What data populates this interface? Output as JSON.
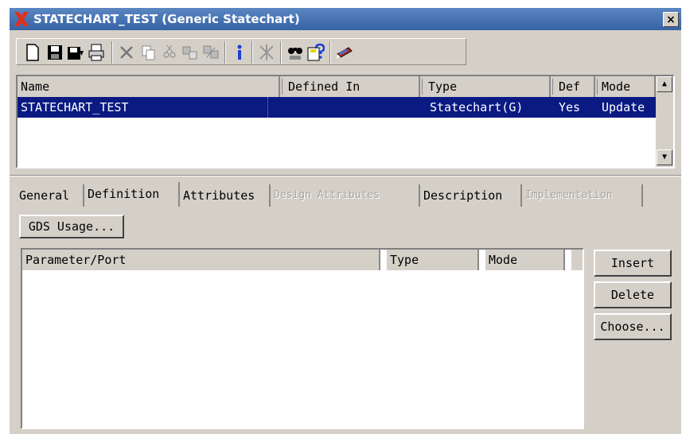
{
  "window": {
    "title": "STATECHART_TEST (Generic Statechart)",
    "close_label": "×",
    "accent": "#3763a6",
    "selection_color": "#0a1a82"
  },
  "toolbar": {
    "icons": [
      "new-icon",
      "save-icon",
      "save-as-icon",
      "print-icon",
      "delete-icon",
      "copy-icon",
      "paste-icon",
      "cut-icon",
      "compare-icon",
      "info-icon",
      "tools-icon",
      "find-icon",
      "help-icon",
      "pencil-icon"
    ]
  },
  "list": {
    "columns": [
      "Name",
      "Defined In",
      "Type",
      "Def",
      "Mode"
    ],
    "rows": [
      {
        "name": "STATECHART_TEST",
        "defined_in": "",
        "type": "Statechart(G)",
        "def": "Yes",
        "mode": "Update"
      }
    ]
  },
  "tabs": [
    {
      "label": "General",
      "state": "normal"
    },
    {
      "label": "Definition",
      "state": "active"
    },
    {
      "label": "Attributes",
      "state": "normal"
    },
    {
      "label": "Design Attributes",
      "state": "disabled"
    },
    {
      "label": "Description",
      "state": "normal"
    },
    {
      "label": "Implementation",
      "state": "disabled"
    }
  ],
  "definition": {
    "gds_usage_label": "GDS Usage...",
    "param_columns": [
      "Parameter/Port",
      "Type",
      "Mode"
    ],
    "buttons": {
      "insert": "Insert",
      "delete": "Delete",
      "choose": "Choose..."
    }
  }
}
